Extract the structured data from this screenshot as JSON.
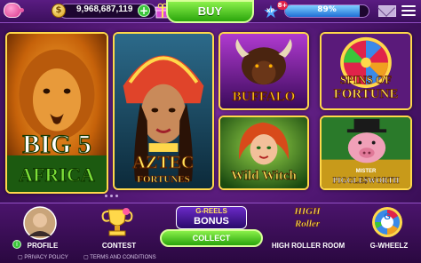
{
  "topbar": {
    "balance": "9,968,687,119",
    "coin_symbol": "$",
    "plus_symbol": "+",
    "buy_label": "BUY",
    "xp_label": "XP",
    "level": "8+",
    "xp_percent_text": "89%",
    "xp_fraction": 0.89
  },
  "games": [
    {
      "title_line1": "BIG 5",
      "title_line2": "AFRICA"
    },
    {
      "title_line1": "AZTEC",
      "title_line2": "FORTUNES"
    },
    {
      "title_line1": "BUFFALO"
    },
    {
      "title_line1": "SPINS OF",
      "title_line2": "FORTUNE"
    },
    {
      "title_line1": "Wild Witch"
    },
    {
      "title_line1": "MISTER",
      "title_line2": "PIGGLE$WORTH"
    }
  ],
  "bottom_nav": {
    "profile_label": "PROFILE",
    "contest_label": "CONTEST",
    "collect_label": "COLLECT",
    "greels_line1": "G-REELS",
    "greels_line2": "BONUS",
    "high_roller_label": "HIGH ROLLER ROOM",
    "high_roller_logo_1": "HIGH",
    "high_roller_logo_2": "Roller",
    "gwheelz_label": "G-WHEELZ",
    "gwheelz_logo": "G"
  },
  "footer": {
    "privacy": "PRIVACY POLICY",
    "terms": "TERMS AND CONDITIONS"
  },
  "colors": {
    "background": "#4e1670",
    "accent_green": "#2aa50c",
    "gold_border": "#ffd84a",
    "xp_blue": "#1f6fd6"
  }
}
